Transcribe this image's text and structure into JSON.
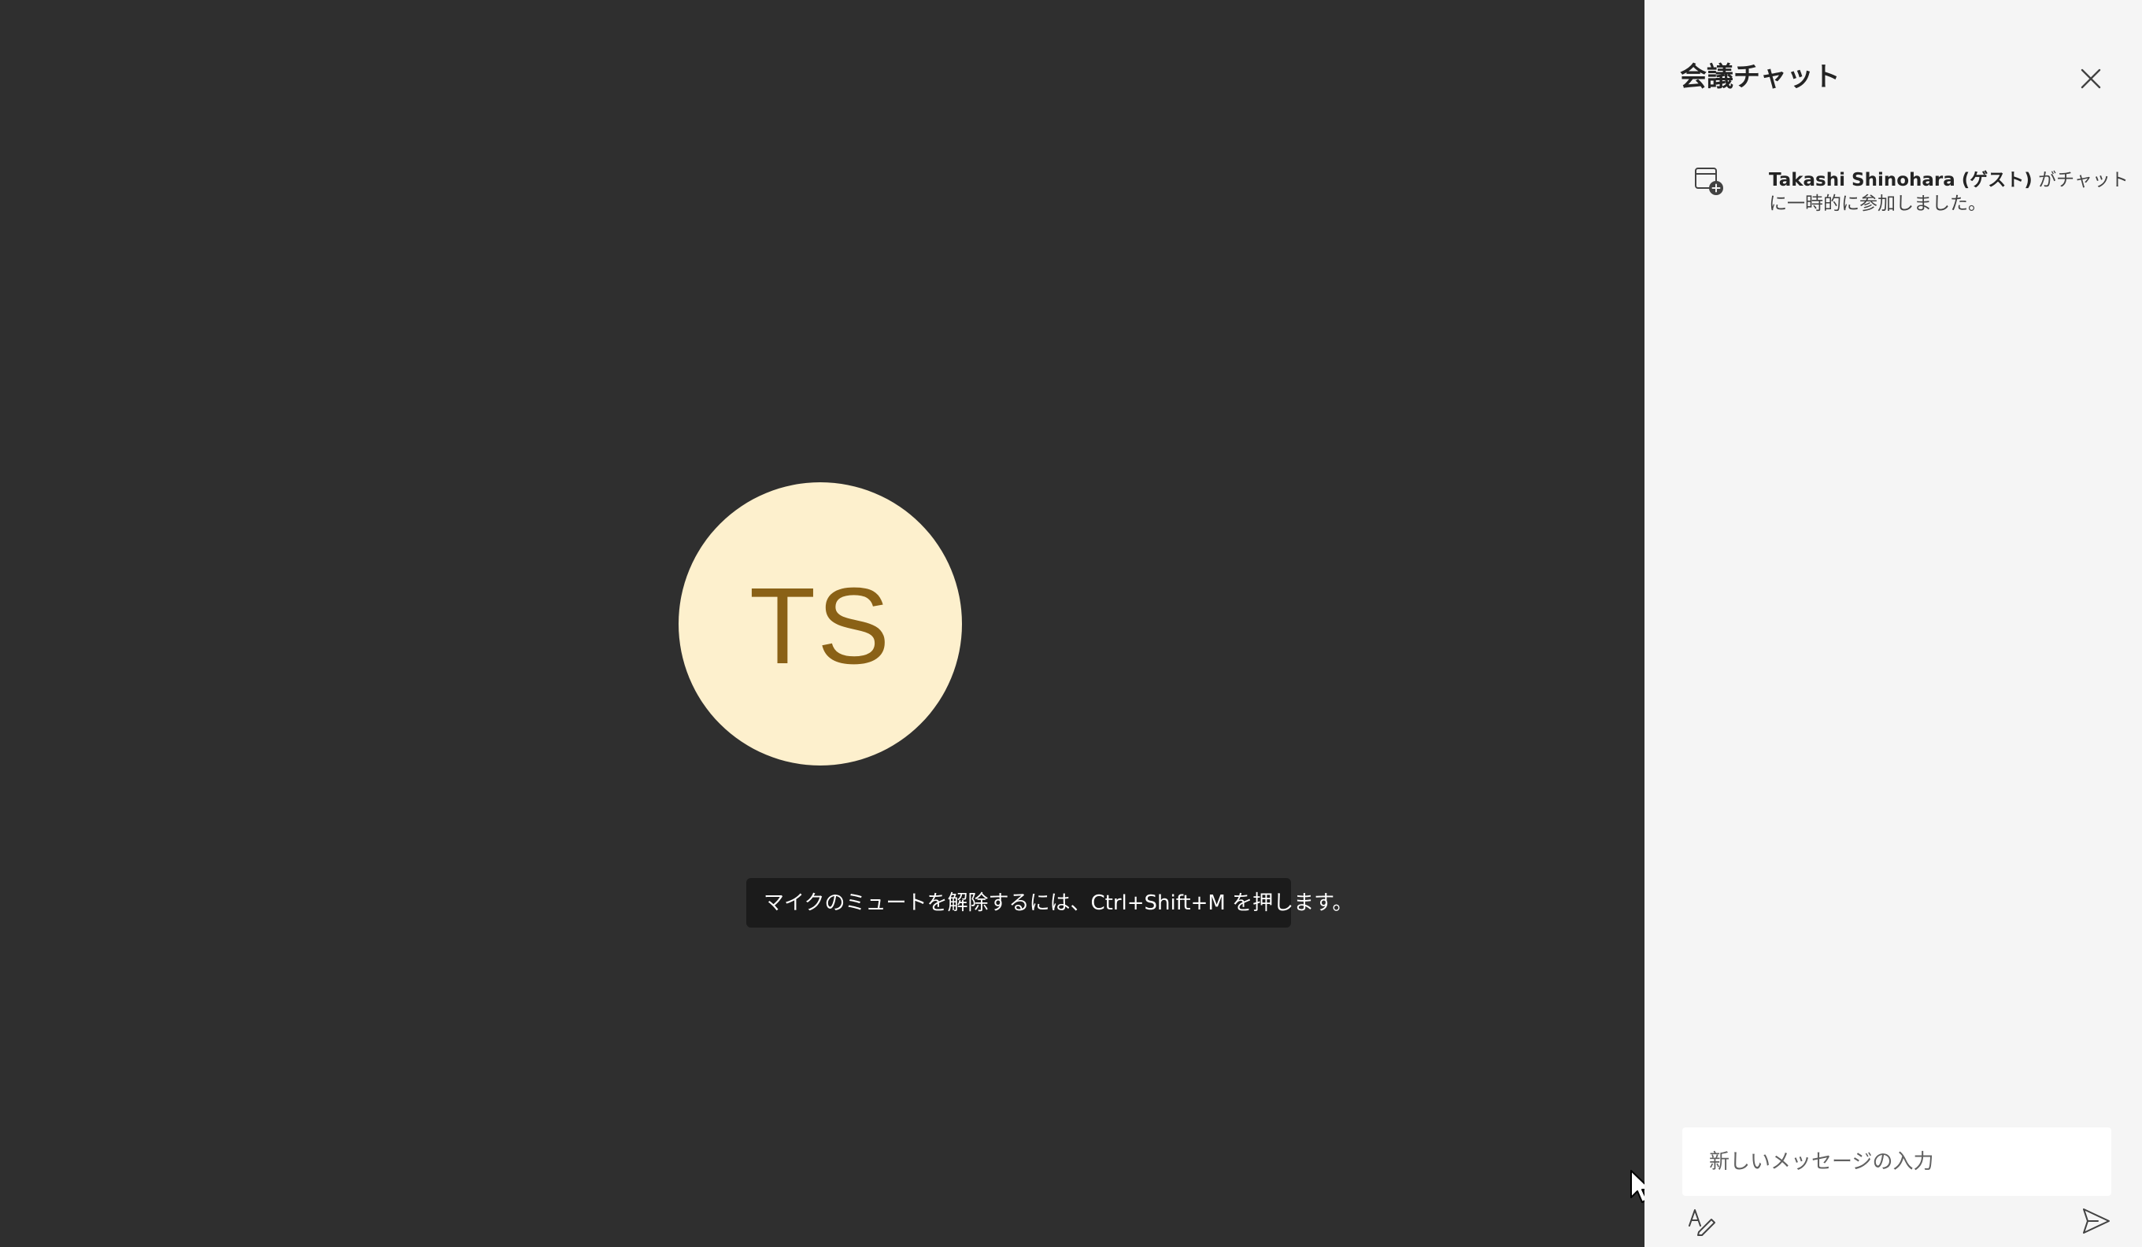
{
  "stage": {
    "avatar": {
      "initials": "TS",
      "background_color": "#fdf0cd",
      "text_color": "#8a6116"
    },
    "toast": {
      "text": "マイクのミュートを解除するには、Ctrl+Shift+M を押します。"
    }
  },
  "chat": {
    "title": "会議チャット",
    "close_icon": "close-icon",
    "system_message": {
      "icon": "calendar-add-icon",
      "name": "Takashi Shinohara (ゲスト)",
      "text": " がチャットに一時的に参加しました。"
    },
    "compose": {
      "placeholder": "新しいメッセージの入力",
      "format_icon": "format-text-icon",
      "send_icon": "send-icon"
    }
  }
}
